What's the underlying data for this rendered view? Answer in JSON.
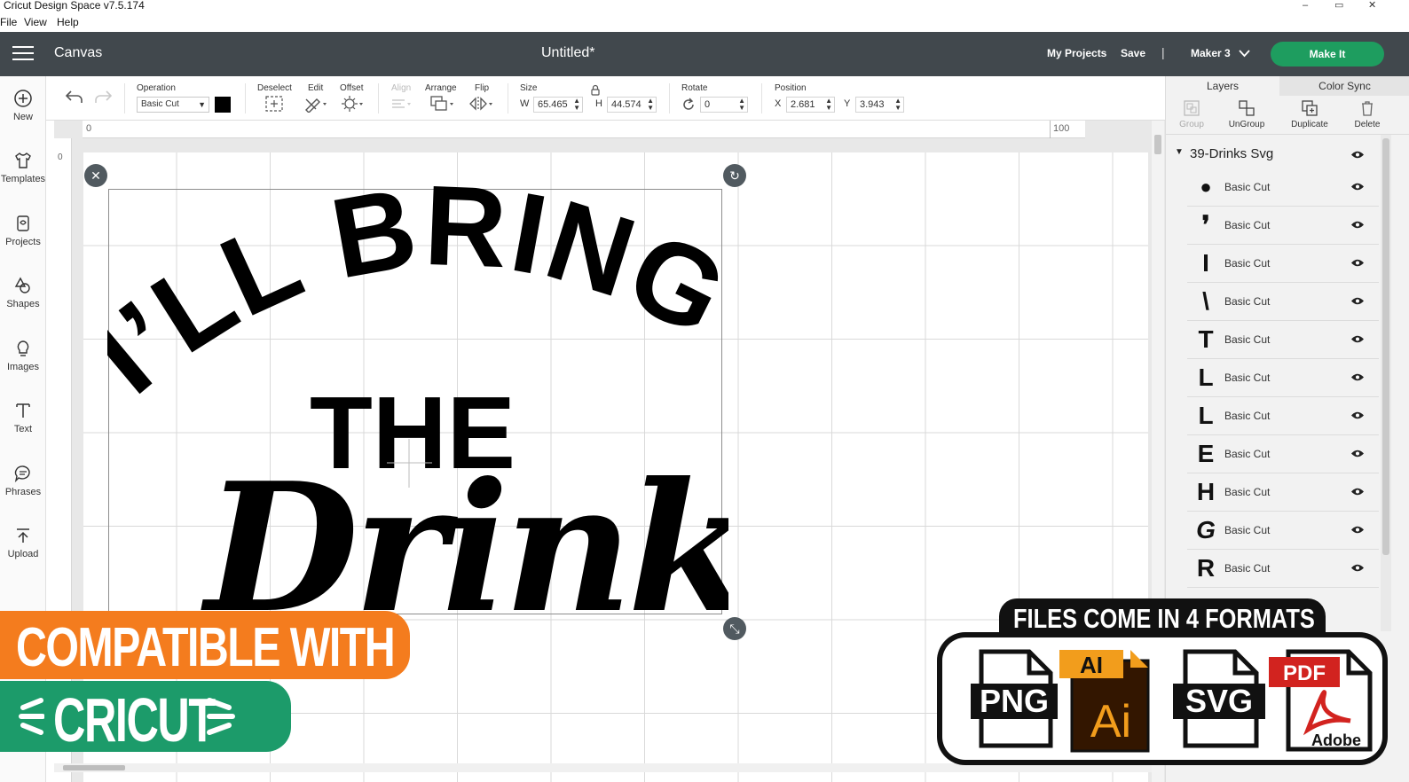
{
  "window": {
    "title": "Cricut Design Space  v7.5.174",
    "controls": {
      "minimize": "–",
      "restore": "▭",
      "close": "✕"
    }
  },
  "menu": [
    "File",
    "View",
    "Help"
  ],
  "topbar": {
    "section": "Canvas",
    "doc_title": "Untitled*",
    "my_projects": "My Projects",
    "save": "Save",
    "separator": "|",
    "machine": "Maker 3",
    "make_it": "Make It"
  },
  "sidebar": {
    "items": [
      {
        "label": "New",
        "icon": "plus-circle-icon"
      },
      {
        "label": "Templates",
        "icon": "shirt-icon"
      },
      {
        "label": "Projects",
        "icon": "projects-icon"
      },
      {
        "label": "Shapes",
        "icon": "shapes-icon"
      },
      {
        "label": "Images",
        "icon": "lightbulb-icon"
      },
      {
        "label": "Text",
        "icon": "text-icon"
      },
      {
        "label": "Phrases",
        "icon": "speech-bubble-icon"
      },
      {
        "label": "Upload",
        "icon": "upload-icon"
      }
    ]
  },
  "toolbar": {
    "operation_label": "Operation",
    "operation_value": "Basic Cut",
    "deselect": "Deselect",
    "edit": "Edit",
    "offset": "Offset",
    "align": "Align",
    "arrange": "Arrange",
    "flip": "Flip",
    "size_label": "Size",
    "w_label": "W",
    "w_value": "65.465",
    "h_label": "H",
    "h_value": "44.574",
    "rotate_label": "Rotate",
    "rotate_value": "0",
    "position_label": "Position",
    "x_label": "X",
    "x_value": "2.681",
    "y_label": "Y",
    "y_value": "3.943",
    "swatch_color": "#000000"
  },
  "canvas": {
    "ruler_top_start": "0",
    "ruler_top_end": "100",
    "ruler_left_start": "0",
    "design_line1": "I’LL BRING",
    "design_line2": "THE",
    "design_line3": "Drinks"
  },
  "layers_panel": {
    "tabs": [
      "Layers",
      "Color Sync"
    ],
    "actions": [
      "Group",
      "UnGroup",
      "Duplicate",
      "Delete"
    ],
    "group_name": "39-Drinks Svg",
    "layers": [
      {
        "glyph": "●",
        "label": "Basic Cut"
      },
      {
        "glyph": "❜",
        "label": "Basic Cut"
      },
      {
        "glyph": "I",
        "label": "Basic Cut"
      },
      {
        "glyph": "\\",
        "label": "Basic Cut"
      },
      {
        "glyph": "T",
        "label": "Basic Cut"
      },
      {
        "glyph": "L",
        "label": "Basic Cut"
      },
      {
        "glyph": "L",
        "label": "Basic Cut"
      },
      {
        "glyph": "E",
        "label": "Basic Cut"
      },
      {
        "glyph": "H",
        "label": "Basic Cut"
      },
      {
        "glyph": "G",
        "label": "Basic Cut"
      },
      {
        "glyph": "R",
        "label": "Basic Cut"
      }
    ]
  },
  "promo": {
    "compatible": "COMPATIBLE WITH",
    "cricut": "CRICUT",
    "formats_title": "FILES COME IN 4 FORMATS",
    "formats": [
      "PNG",
      "AI",
      "Ai",
      "SVG",
      "PDF",
      "Adobe"
    ]
  },
  "colors": {
    "topbar": "#41484d",
    "make_it": "#1e9d5f",
    "orange": "#f47c1e",
    "green": "#1c9b6a",
    "ai_orange": "#f29d1c",
    "ai_dark": "#331600",
    "pdf_red": "#d2231f"
  }
}
